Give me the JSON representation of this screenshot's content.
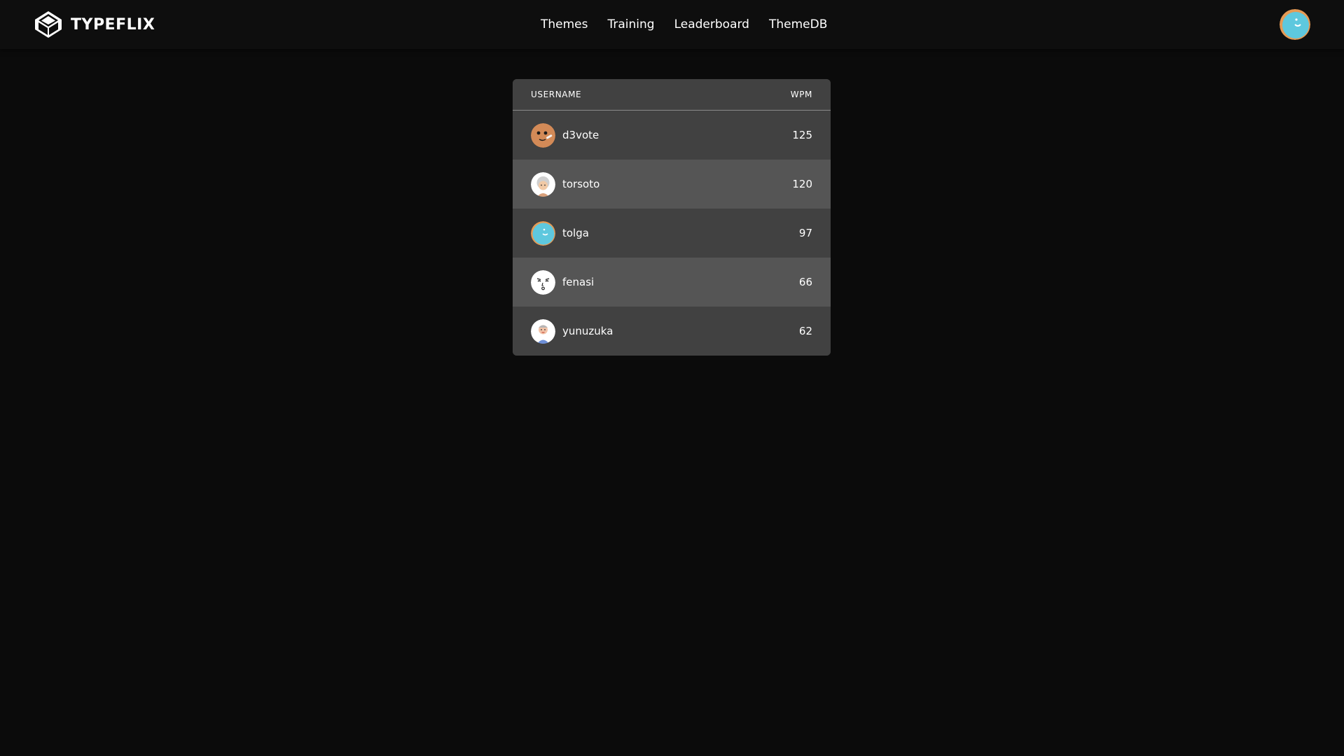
{
  "brand": {
    "name": "TYPEFLIX",
    "icon": "keycap-logo-icon"
  },
  "nav": {
    "items": [
      {
        "label": "Themes"
      },
      {
        "label": "Training"
      },
      {
        "label": "Leaderboard"
      },
      {
        "label": "ThemeDB"
      }
    ]
  },
  "profile": {
    "icon": "user-avatar-icon",
    "colors": {
      "ring": "#e59a55",
      "face": "#5ec8de"
    }
  },
  "leaderboard": {
    "columns": [
      "USERNAME",
      "WPM"
    ],
    "rows": [
      {
        "username": "d3vote",
        "wpm": "125",
        "avatar": "orange-face-avatar-icon"
      },
      {
        "username": "torsoto",
        "wpm": "120",
        "avatar": "grey-hair-avatar-icon"
      },
      {
        "username": "tolga",
        "wpm": "97",
        "avatar": "blue-face-avatar-icon"
      },
      {
        "username": "fenasi",
        "wpm": "66",
        "avatar": "white-face-avatar-icon"
      },
      {
        "username": "yunuzuka",
        "wpm": "62",
        "avatar": "blue-shirt-avatar-icon"
      }
    ]
  },
  "colors": {
    "background": "#0b0b0b",
    "topbar": "#0e0e0e",
    "row_dark": "#414141",
    "row_light": "#555555",
    "text": "#ffffff"
  }
}
